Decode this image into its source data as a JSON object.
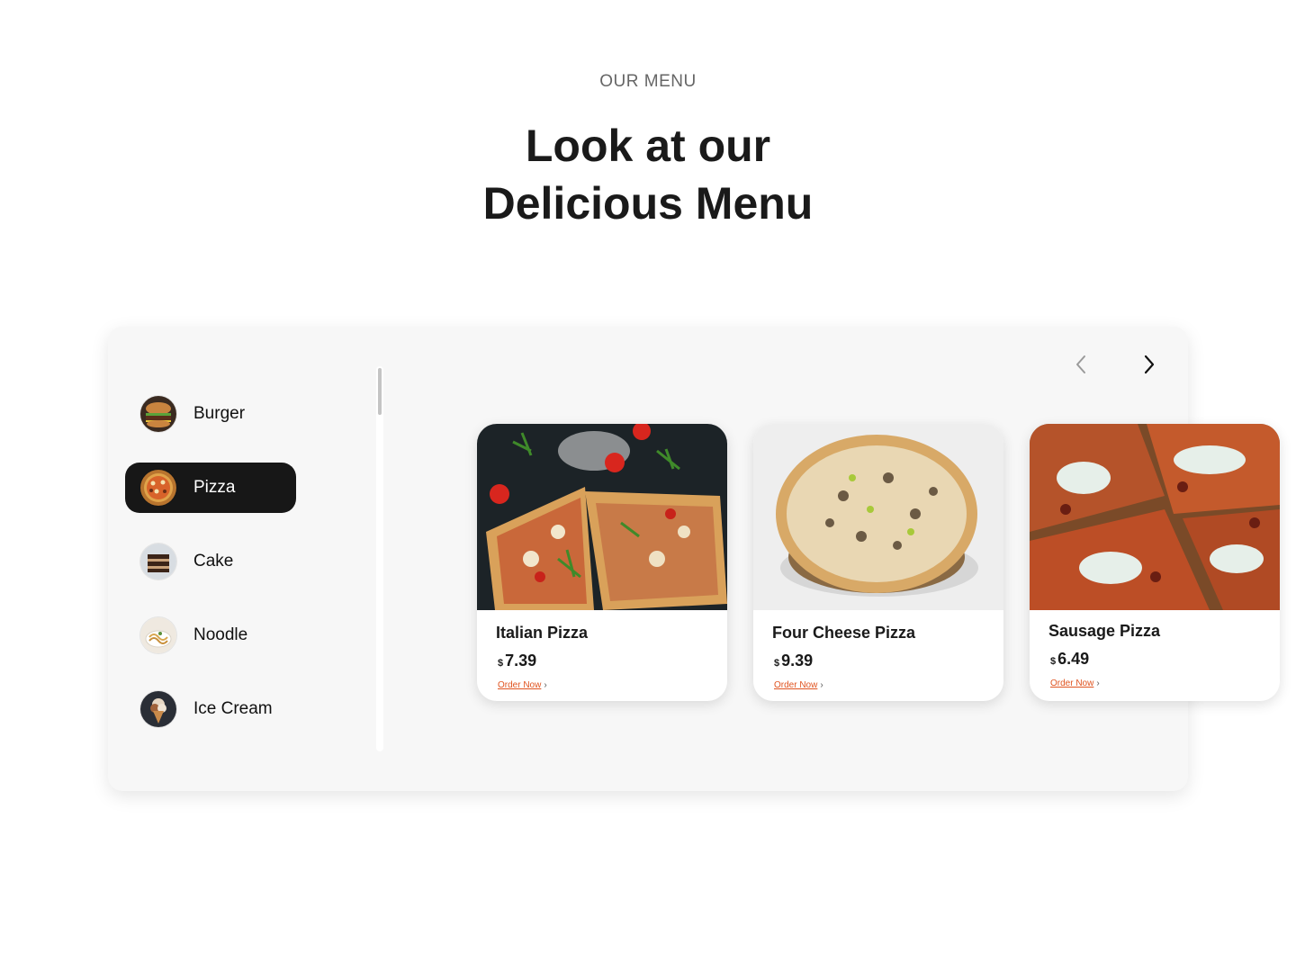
{
  "header": {
    "eyebrow": "OUR MENU",
    "title_line1": "Look at our",
    "title_line2": "Delicious Menu"
  },
  "categories": [
    {
      "label": "Burger",
      "icon": "burger-thumbnail",
      "active": false
    },
    {
      "label": "Pizza",
      "icon": "pizza-thumbnail",
      "active": true
    },
    {
      "label": "Cake",
      "icon": "cake-thumbnail",
      "active": false
    },
    {
      "label": "Noodle",
      "icon": "noodle-thumbnail",
      "active": false
    },
    {
      "label": "Ice Cream",
      "icon": "ice-cream-thumbnail",
      "active": false
    }
  ],
  "carousel": {
    "prev_icon": "chevron-left-icon",
    "next_icon": "chevron-right-icon"
  },
  "products": [
    {
      "name": "Italian Pizza",
      "currency": "$",
      "price": "7.39",
      "cta": "Order Now"
    },
    {
      "name": "Four Cheese Pizza",
      "currency": "$",
      "price": "9.39",
      "cta": "Order Now"
    },
    {
      "name": "Sausage Pizza",
      "currency": "$",
      "price": "6.49",
      "cta": "Order Now"
    }
  ],
  "colors": {
    "accent": "#e0531f",
    "active_bg": "#171717",
    "panel_bg": "#f7f7f7"
  }
}
